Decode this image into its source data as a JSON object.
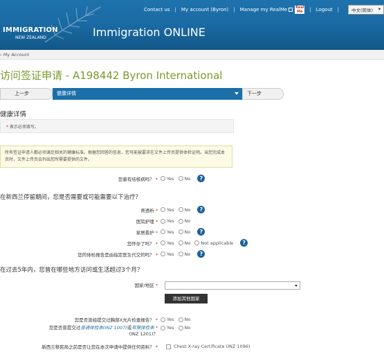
{
  "header": {
    "logo_text": "IMMIGRATION",
    "logo_sub": "NEW ZEALAND",
    "site_title": "Immigration ONLINE",
    "nav": {
      "contact": "Contact us",
      "account": "My account (Byron)",
      "realme": "Manage my RealMe",
      "logout": "Logout",
      "language": "中文(简体)"
    }
  },
  "breadcrumb": "My Account",
  "page_title": "访问签证申请 - A198442 Byron International",
  "stepnav": {
    "prev": "上一步",
    "current": "健康详情",
    "next": "下一步"
  },
  "section": {
    "heading": "健康详情",
    "required_note": "表示必须填写。",
    "info": "所有签证申请人都必须满足相关的健康标准。根据您回答的信息，您可能被要求在文件上传页提供体检证明。当您完成本页时，文件上传页会列出您所需要提供的文件。"
  },
  "options": {
    "yes": "Yes",
    "no": "No",
    "not_applicable": "Not applicable"
  },
  "q_tb": "您患有结核病吗？",
  "group1_heading": "在新西兰停留期间，您是否需要或可能需要以下治疗？",
  "group1_items": [
    "肾透析",
    "医院护理",
    "家居看护",
    "您怀孕了吗？",
    "您的体检报告是由指定医生代交的吗？"
  ],
  "group2_heading": "在过去5年内，您曾在哪些地方访问或生活超过3个月？",
  "country_label": "国家/地区",
  "add_country": "添加其他国家",
  "q_xray": "您是否曾经提交过胸部X光片检查报告？",
  "q_medical_pre": "您是否曾提交过",
  "q_medical_link1": "普通体检表(INZ 1007)",
  "q_medical_mid": "或",
  "q_medical_link2": "有限体检表",
  "q_medical_post": "(INZ 1201)？",
  "q_cert": "新西兰移民局之前是否让您在本次申请中提供任何资料？",
  "cert_option": "Chest X-ray Certificate (INZ 1096)",
  "help_glyph": "?",
  "required_mark": "*"
}
